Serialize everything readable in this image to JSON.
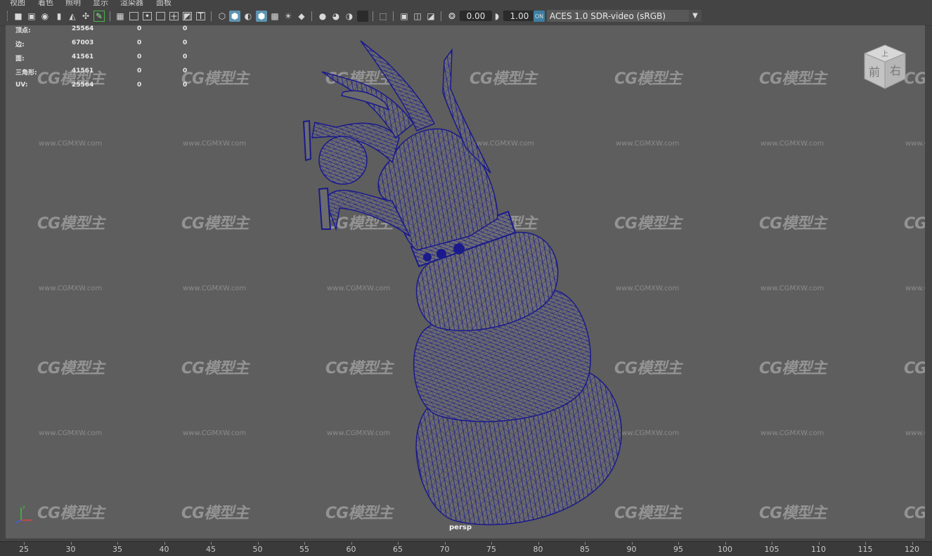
{
  "menu": {
    "items": [
      "视图",
      "着色",
      "照明",
      "显示",
      "渲染器",
      "面板"
    ]
  },
  "toolbar": {
    "exposure_value": "0.00",
    "gamma_value": "1.00",
    "color_management": "ACES 1.0 SDR-video (sRGB)",
    "accent_color": "#5d94b0"
  },
  "hud": {
    "rows": [
      {
        "label": "顶点:",
        "count": "25564",
        "sel": "0",
        "tri": "0"
      },
      {
        "label": "边:",
        "count": "67003",
        "sel": "0",
        "tri": "0"
      },
      {
        "label": "面:",
        "count": "41561",
        "sel": "0",
        "tri": "0"
      },
      {
        "label": "三角形:",
        "count": "41561",
        "sel": "0",
        "tri": "0"
      },
      {
        "label": "UV:",
        "count": "25564",
        "sel": "0",
        "tri": "0"
      }
    ]
  },
  "viewport": {
    "camera_label": "persp",
    "wireframe_color": "#1a1a8c",
    "viewcube": {
      "top": "上",
      "front": "前",
      "right": "右"
    }
  },
  "watermark": {
    "logo": "CG模型主",
    "url": "www.CGMXW.com"
  },
  "ruler": {
    "ticks": [
      "25",
      "30",
      "35",
      "40",
      "45",
      "50",
      "55",
      "60",
      "65",
      "70",
      "75",
      "80",
      "85",
      "90",
      "95",
      "100",
      "105",
      "110",
      "115",
      "120"
    ]
  }
}
